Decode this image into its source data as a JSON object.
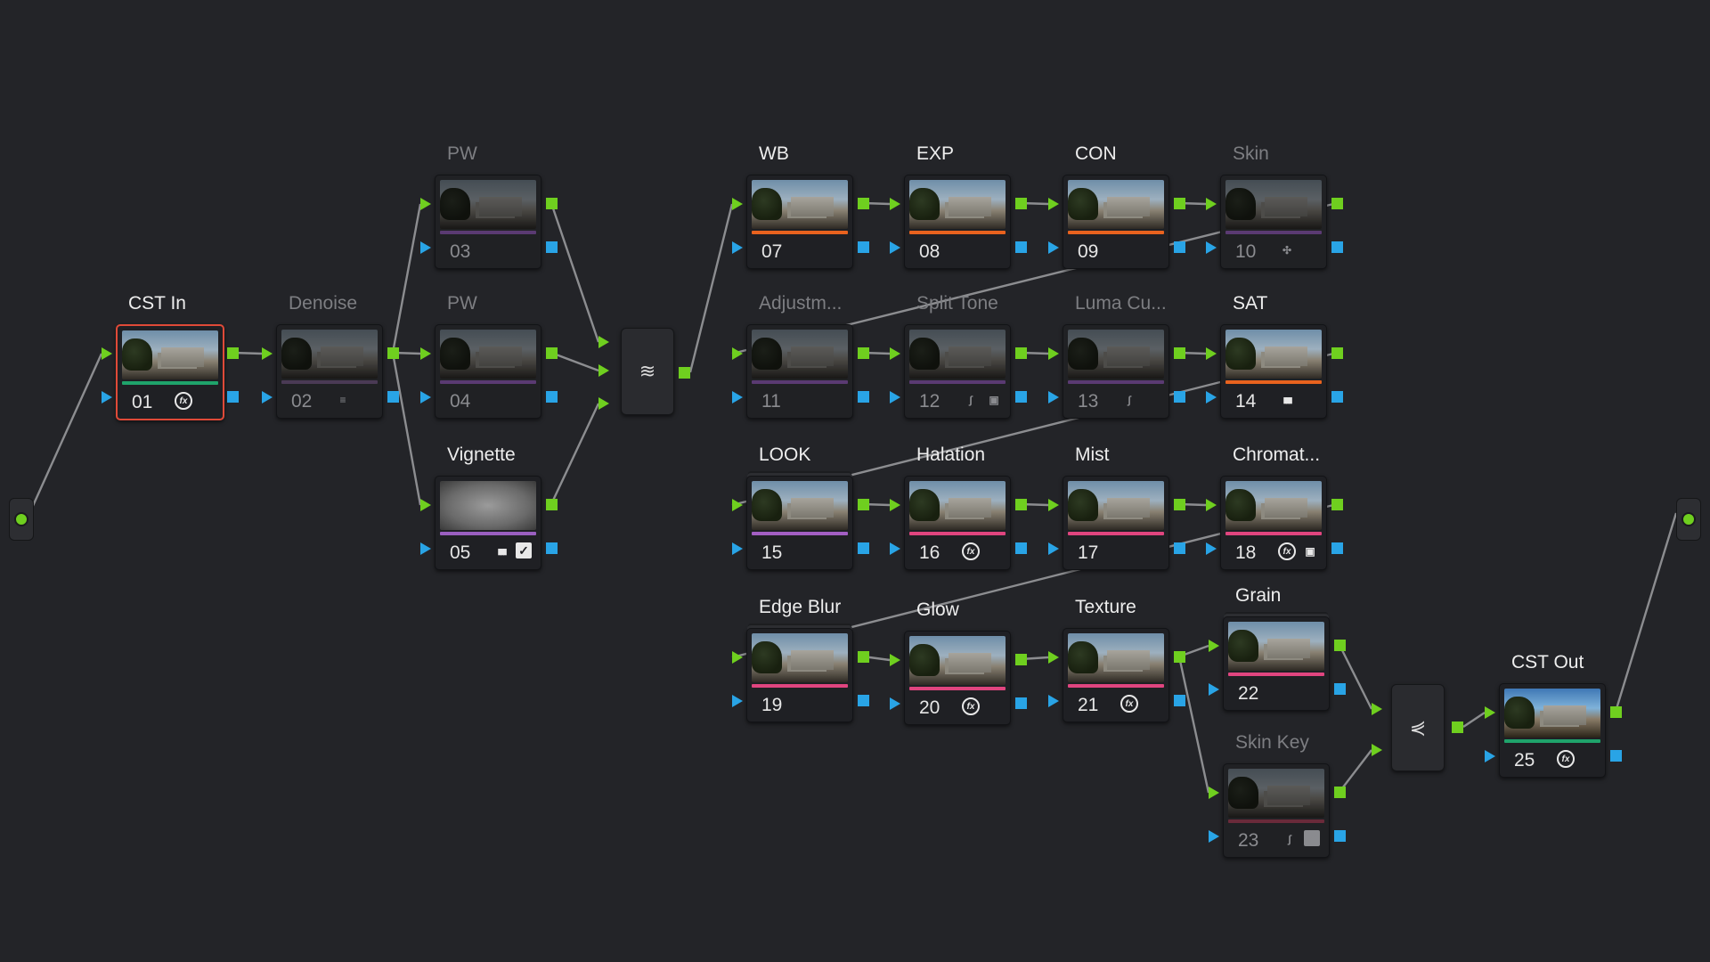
{
  "nodes": [
    {
      "id": "01",
      "label": "CST In",
      "active": true,
      "selected": true,
      "bar": "#1fa36b",
      "icons": [
        "fx"
      ]
    },
    {
      "id": "02",
      "label": "Denoise",
      "active": false,
      "bar": "#4a3a55",
      "icons": [
        "denoise"
      ]
    },
    {
      "id": "03",
      "label": "PW",
      "active": false,
      "bar": "#5a3a72",
      "icons": []
    },
    {
      "id": "04",
      "label": "PW",
      "active": false,
      "bar": "#5a3a72",
      "icons": []
    },
    {
      "id": "05",
      "label": "Vignette",
      "active": true,
      "bar": "#9a5fc0",
      "icons": [
        "bars",
        "check"
      ]
    },
    {
      "id": "07",
      "label": "WB",
      "active": true,
      "bar": "#e8621e",
      "icons": []
    },
    {
      "id": "08",
      "label": "EXP",
      "active": true,
      "bar": "#e8621e",
      "icons": []
    },
    {
      "id": "09",
      "label": "CON",
      "active": true,
      "bar": "#e8621e",
      "icons": []
    },
    {
      "id": "10",
      "label": "Skin",
      "active": false,
      "bar": "#5a3a72",
      "icons": [
        "qualifier"
      ]
    },
    {
      "id": "11",
      "label": "Adjustm...",
      "active": false,
      "bar": "#5a3a72",
      "icons": []
    },
    {
      "id": "12",
      "label": "Split Tone",
      "active": false,
      "bar": "#5a3a72",
      "icons": [
        "curve",
        "window"
      ]
    },
    {
      "id": "13",
      "label": "Luma Cu...",
      "active": false,
      "bar": "#5a3a72",
      "icons": [
        "curve"
      ]
    },
    {
      "id": "14",
      "label": "SAT",
      "active": true,
      "bar": "#e8621e",
      "icons": [
        "bars"
      ]
    },
    {
      "id": "15",
      "label": "LOOK",
      "active": true,
      "bar": "#a35fc4",
      "icons": []
    },
    {
      "id": "16",
      "label": "Halation",
      "active": true,
      "bar": "#e0457f",
      "icons": [
        "fx"
      ]
    },
    {
      "id": "17",
      "label": "Mist",
      "active": true,
      "bar": "#e0457f",
      "icons": []
    },
    {
      "id": "18",
      "label": "Chromat...",
      "active": true,
      "bar": "#e0457f",
      "icons": [
        "fx",
        "window"
      ]
    },
    {
      "id": "19",
      "label": "Edge Blur",
      "active": true,
      "bar": "#e0457f",
      "icons": []
    },
    {
      "id": "20",
      "label": "Glow",
      "active": true,
      "bar": "#e0457f",
      "icons": [
        "fx"
      ]
    },
    {
      "id": "21",
      "label": "Texture",
      "active": true,
      "bar": "#e0457f",
      "icons": [
        "fx"
      ]
    },
    {
      "id": "22",
      "label": "Grain",
      "active": true,
      "bar": "#e0457f",
      "icons": []
    },
    {
      "id": "23",
      "label": "Skin Key",
      "active": false,
      "bar": "#6a2a3a",
      "icons": [
        "curve",
        "check"
      ]
    },
    {
      "id": "25",
      "label": "CST Out",
      "active": true,
      "bar": "#1fa36b",
      "icons": [
        "fx"
      ]
    }
  ],
  "mixers": [
    {
      "name": "layer-mixer",
      "glyph": "≋"
    },
    {
      "name": "parallel-mixer",
      "glyph": "⋞"
    }
  ],
  "icon_glyphs": {
    "fx": "fx",
    "bars": "▮▮▮",
    "check": "✓",
    "curve": "∫",
    "window": "▣",
    "qualifier": "✣",
    "denoise": "≡"
  }
}
